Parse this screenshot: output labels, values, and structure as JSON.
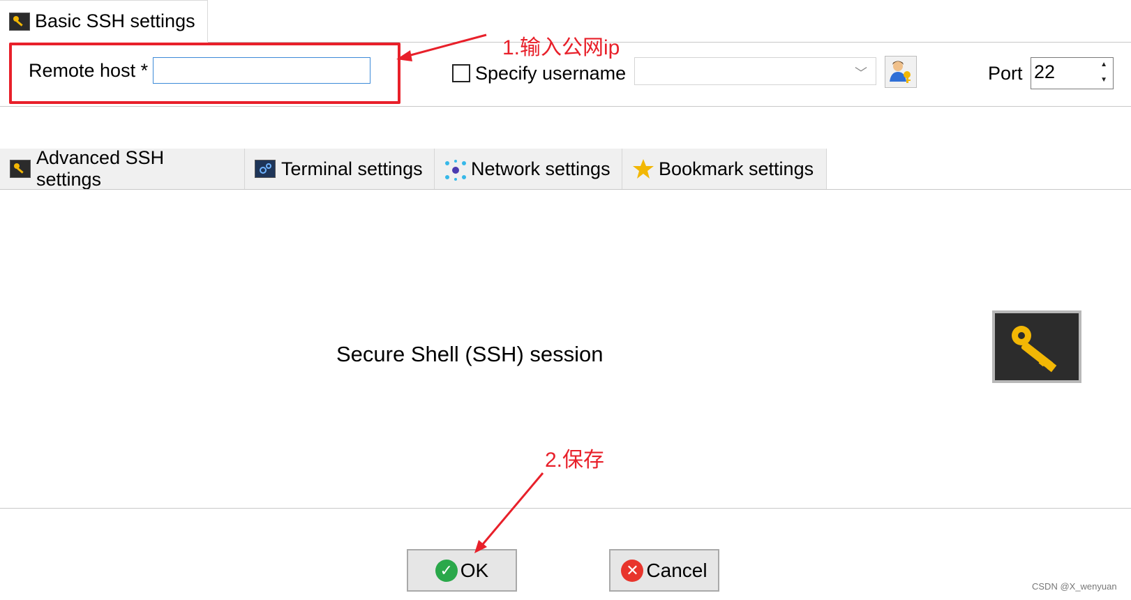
{
  "basic_tab": {
    "label": "Basic SSH settings",
    "icon": "key-icon"
  },
  "remote_host": {
    "label": "Remote host *",
    "value": ""
  },
  "specify_username": {
    "label": "Specify username",
    "checked": false,
    "value": ""
  },
  "user_button": {
    "icon": "user-key-icon"
  },
  "port": {
    "label": "Port",
    "value": "22"
  },
  "tabs": [
    {
      "label": "Advanced SSH settings",
      "icon": "key-icon"
    },
    {
      "label": "Terminal settings",
      "icon": "terminal-gear-icon"
    },
    {
      "label": "Network settings",
      "icon": "network-icon"
    },
    {
      "label": "Bookmark settings",
      "icon": "star-icon"
    }
  ],
  "session": {
    "title": "Secure Shell (SSH) session",
    "icon": "big-key-icon"
  },
  "buttons": {
    "ok": "OK",
    "cancel": "Cancel"
  },
  "annotations": {
    "step1": "1.输入公网ip",
    "step2": "2.保存"
  },
  "watermark": "CSDN @X_wenyuan",
  "colors": {
    "annotation_red": "#e8202a",
    "ok_green": "#2aa84a",
    "cancel_red": "#e8352c",
    "key_gold": "#f2b705"
  }
}
